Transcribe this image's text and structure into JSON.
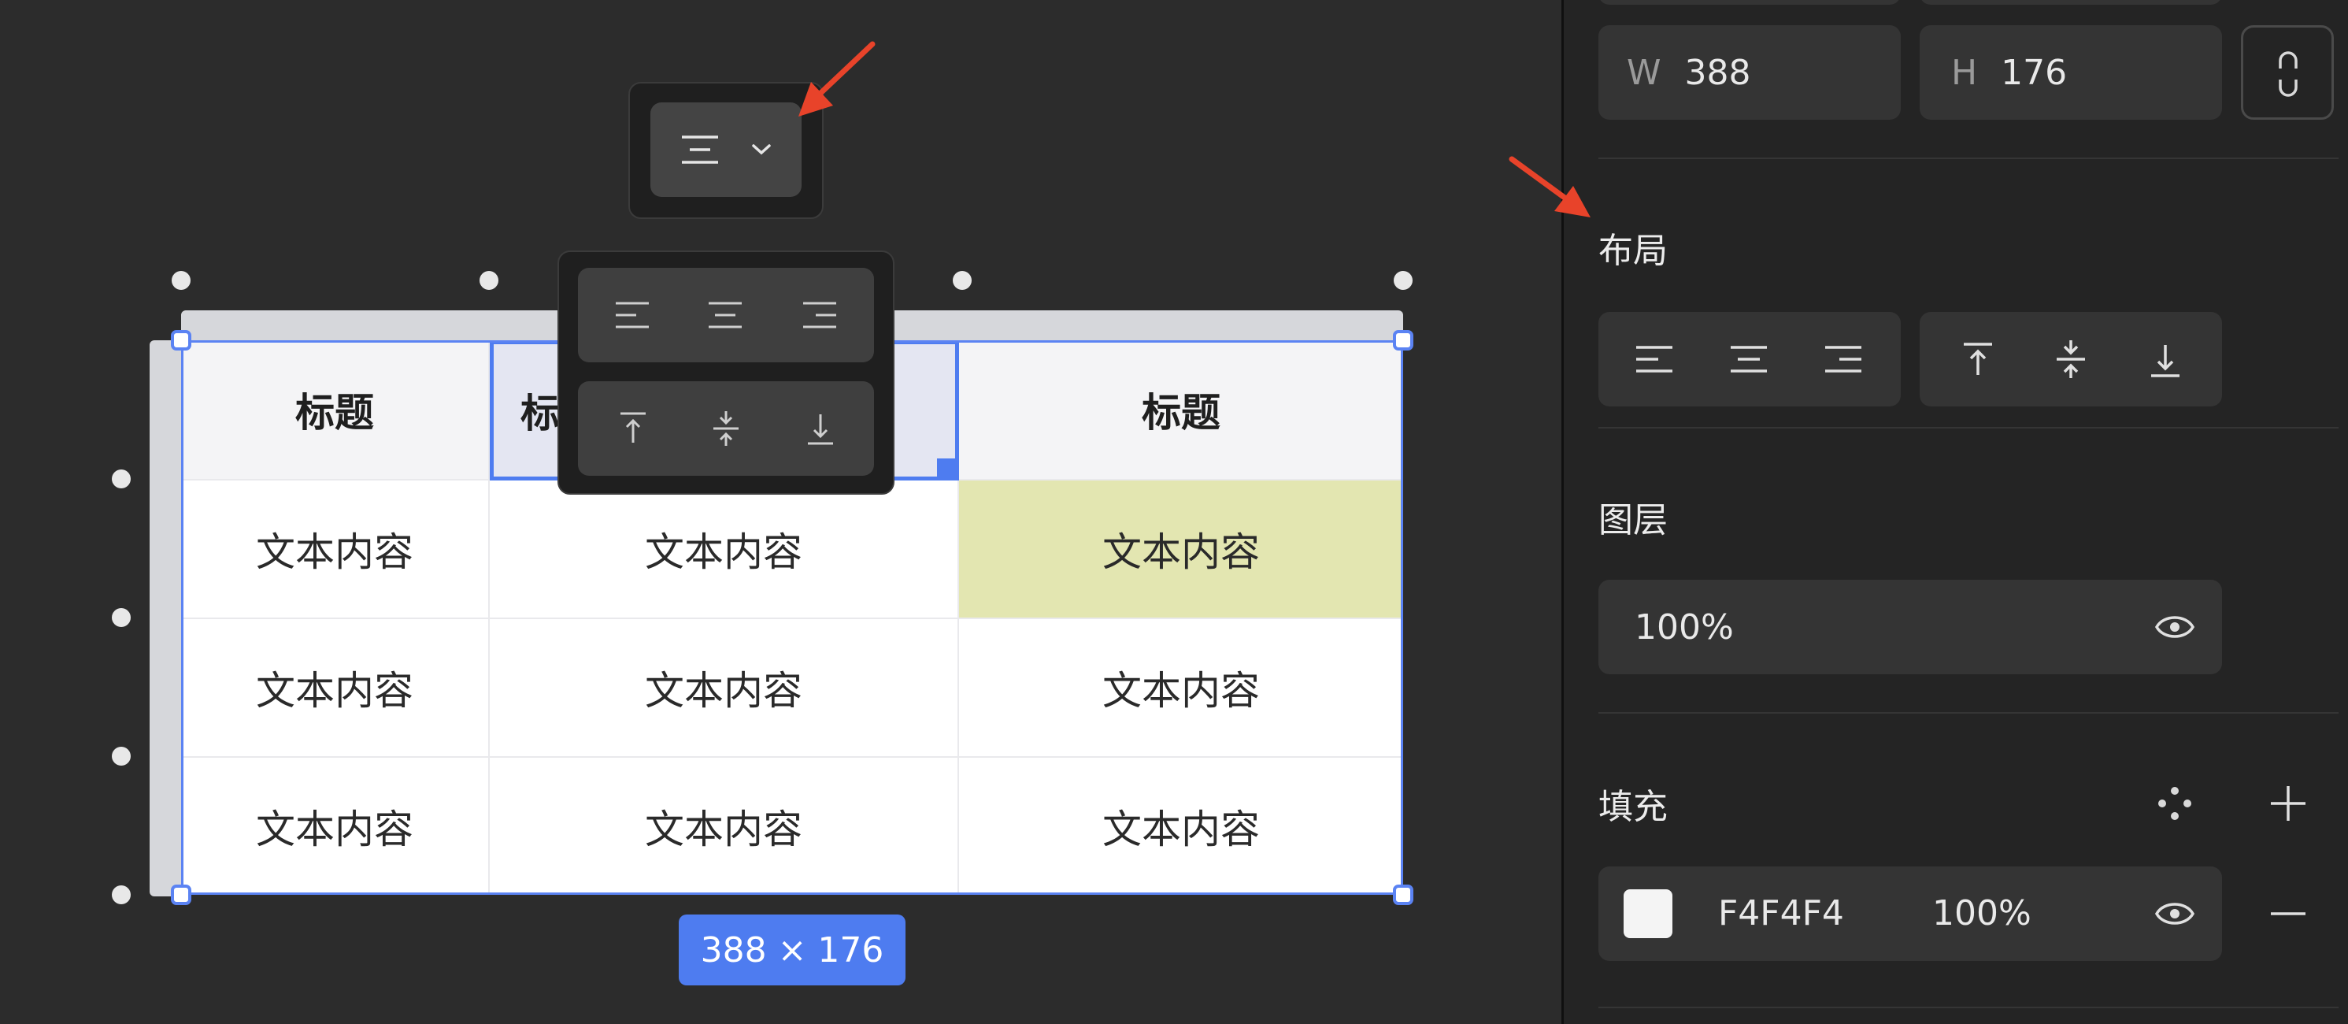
{
  "table": {
    "header": [
      "标题",
      "标",
      "标题"
    ],
    "rows": [
      [
        "文本内容",
        "文本内容",
        "文本内容"
      ],
      [
        "文本内容",
        "文本内容",
        "文本内容"
      ],
      [
        "文本内容",
        "文本内容",
        "文本内容"
      ]
    ]
  },
  "size_label": "388 × 176",
  "panel": {
    "w_label": "W",
    "w_value": "388",
    "h_label": "H",
    "h_value": "176",
    "layout_title": "布局",
    "layer_title": "图层",
    "layer_opacity": "100%",
    "fill_title": "填充",
    "fill_hex": "F4F4F4",
    "fill_opacity": "100%"
  },
  "colors": {
    "accent": "#4e7cf0",
    "highlight_cell": "#e3e6b1",
    "annotation_arrow": "#e8432a",
    "fill_swatch": "#f4f4f4"
  }
}
